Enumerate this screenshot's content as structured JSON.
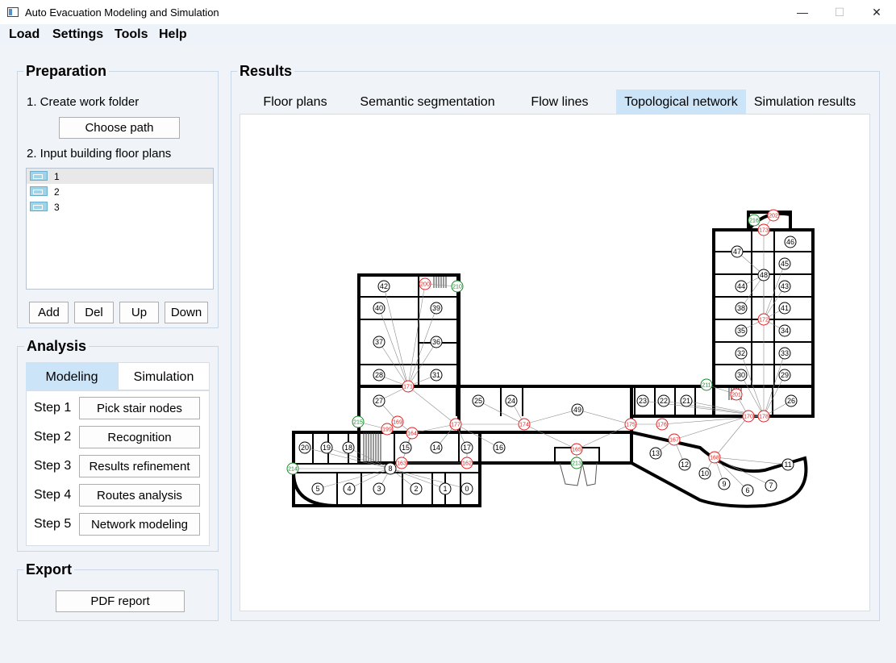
{
  "window": {
    "title": "Auto Evacuation Modeling and Simulation",
    "minimize": "—",
    "maximize": "☐",
    "close": "✕"
  },
  "menu": [
    "Load",
    "Settings",
    "Tools",
    "Help"
  ],
  "preparation": {
    "title": "Preparation",
    "step1": "1. Create work folder",
    "choose_path": "Choose path",
    "step2": "2. Input building floor plans",
    "floors": [
      "1",
      "2",
      "3"
    ],
    "buttons": {
      "add": "Add",
      "del": "Del",
      "up": "Up",
      "down": "Down"
    }
  },
  "analysis": {
    "title": "Analysis",
    "tabs": [
      "Modeling",
      "Simulation"
    ],
    "active_tab": "Modeling",
    "steps": [
      {
        "label": "Step 1",
        "button": "Pick stair nodes"
      },
      {
        "label": "Step 2",
        "button": "Recognition"
      },
      {
        "label": "Step 3",
        "button": "Results refinement"
      },
      {
        "label": "Step 4",
        "button": "Routes analysis"
      },
      {
        "label": "Step 5",
        "button": "Network modeling"
      }
    ]
  },
  "export": {
    "title": "Export",
    "pdf": "PDF report"
  },
  "results": {
    "title": "Results",
    "tabs": [
      "Floor plans",
      "Semantic segmentation",
      "Flow lines",
      "Topological network",
      "Simulation results"
    ],
    "active_tab": "Topological network"
  },
  "network": {
    "room_nodes": [
      "0",
      "1",
      "2",
      "3",
      "4",
      "5",
      "6",
      "7",
      "8",
      "9",
      "10",
      "11",
      "12",
      "13",
      "14",
      "15",
      "16",
      "17",
      "18",
      "19",
      "20",
      "21",
      "22",
      "23",
      "24",
      "25",
      "26",
      "27",
      "28",
      "29",
      "30",
      "31",
      "32",
      "33",
      "34",
      "35",
      "36",
      "37",
      "38",
      "39",
      "40",
      "41",
      "42",
      "43",
      "44",
      "45",
      "46",
      "47",
      "48",
      "49"
    ],
    "door_nodes": [
      "162",
      "163",
      "164",
      "165",
      "167",
      "168",
      "169",
      "170",
      "171",
      "172",
      "173",
      "174",
      "175",
      "176",
      "177",
      "178",
      "199",
      "200",
      "201",
      "202"
    ],
    "exit_nodes": [
      "210",
      "211",
      "213",
      "214",
      "215",
      "216"
    ]
  },
  "colors": {
    "accent_tab": "#cce4f7",
    "door_node": "#e02020",
    "exit_node": "#1a8a2a",
    "edge": "#8a8a8a"
  }
}
